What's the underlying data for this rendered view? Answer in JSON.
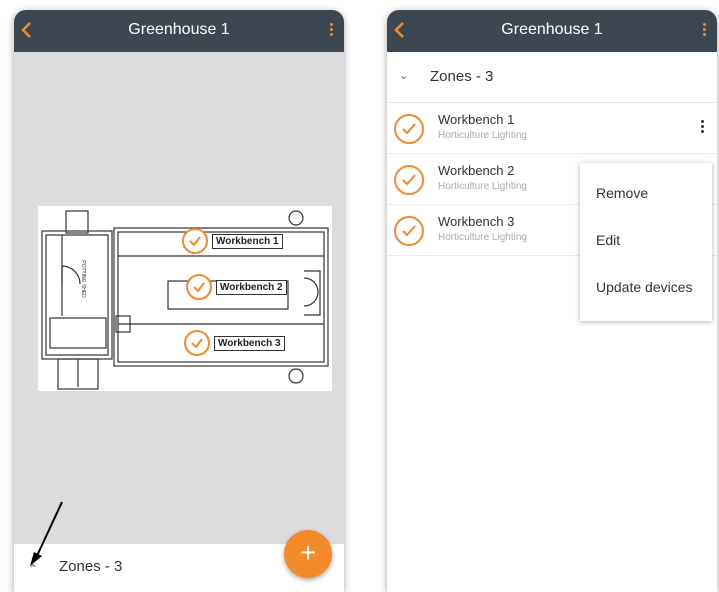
{
  "left_screen": {
    "title": "Greenhouse 1",
    "zones_label": "Zones - 3",
    "fab_label": "+",
    "floorplan": {
      "room_label": "POTTING SHED",
      "markers": [
        {
          "label": "Workbench 1"
        },
        {
          "label": "Workbench 2"
        },
        {
          "label": "Workbench 3"
        }
      ]
    }
  },
  "right_screen": {
    "title": "Greenhouse 1",
    "zones_label": "Zones - 3",
    "items": [
      {
        "name": "Workbench 1",
        "subtitle": "Horticulture Lighting"
      },
      {
        "name": "Workbench 2",
        "subtitle": "Horticulture Lighting"
      },
      {
        "name": "Workbench 3",
        "subtitle": "Horticulture Lighting"
      }
    ],
    "context_menu": [
      "Remove",
      "Edit",
      "Update devices"
    ]
  },
  "colors": {
    "accent": "#f58a2a",
    "appbar": "#3d4751",
    "canvas": "#dcdcdf"
  },
  "icons": [
    "back-chevron-icon",
    "more-vert-icon",
    "check-circle-icon",
    "chevron-up-icon",
    "chevron-down-icon",
    "plus-icon",
    "kebab-menu-icon"
  ]
}
